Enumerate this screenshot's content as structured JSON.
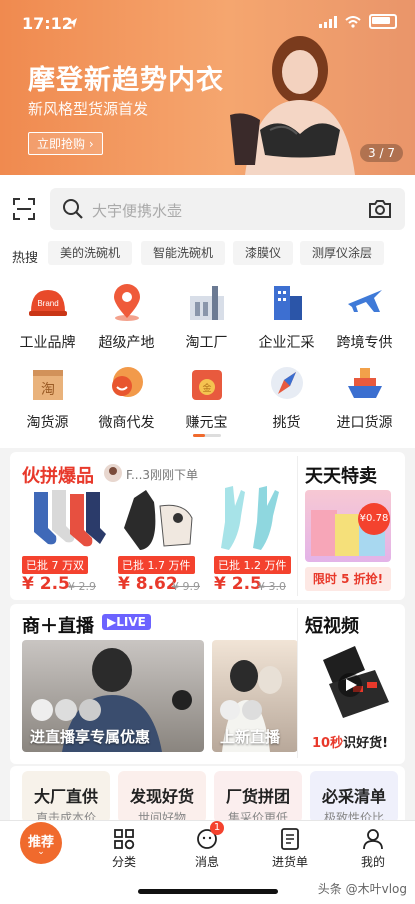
{
  "status": {
    "time": "17:12"
  },
  "banner": {
    "title": "摩登新趋势内衣",
    "subtitle": "新风格型货源首发",
    "button": "立即抢购",
    "page_indicator": "3 / 7"
  },
  "search": {
    "placeholder": "大宇便携水壶"
  },
  "hot": {
    "label": "热搜",
    "items": [
      "美的洗碗机",
      "智能洗碗机",
      "漆膜仪",
      "测厚仪涂层"
    ]
  },
  "categories": [
    {
      "label": "工业品牌",
      "brand_text": "Brand"
    },
    {
      "label": "超级产地"
    },
    {
      "label": "淘工厂"
    },
    {
      "label": "企业汇采"
    },
    {
      "label": "跨境专供"
    },
    {
      "label": "淘货源",
      "icon_text": "淘"
    },
    {
      "label": "微商代发"
    },
    {
      "label": "赚元宝",
      "icon_text": "金"
    },
    {
      "label": "挑货"
    },
    {
      "label": "进口货源"
    }
  ],
  "group_buy": {
    "title": "伙拼爆品",
    "ticker": "F...3刚刚下单",
    "products": [
      {
        "tag": "已批 7 万双",
        "price": "¥ 2.5",
        "original": "¥ 2.9"
      },
      {
        "tag": "已批 1.7 万件",
        "price": "¥ 8.62",
        "original": "¥ 9.9"
      },
      {
        "tag": "已批 1.2 万件",
        "price": "¥ 2.5",
        "original": "¥ 3.0"
      }
    ]
  },
  "daily_sale": {
    "title": "天天特卖",
    "price_badge": "¥0.78",
    "promo": "限时 5 折抢!"
  },
  "live": {
    "title": "商＋直播",
    "badge": "LIVE",
    "caption1": "进直播享专属优惠",
    "caption2": "上新直播"
  },
  "short_video": {
    "title": "短视频",
    "caption_red": "10秒",
    "caption_rest": "识好货!"
  },
  "tiles": [
    {
      "title": "大厂直供",
      "sub": "直击成本价"
    },
    {
      "title": "发现好货",
      "sub": "世间好物"
    },
    {
      "title": "厂货拼团",
      "sub": "集采价更低"
    },
    {
      "title": "必采清单",
      "sub": "极致性价比"
    }
  ],
  "tabbar": {
    "items": [
      {
        "label": "推荐",
        "icon": "home-circle-icon"
      },
      {
        "label": "分类",
        "icon": "grid-icon"
      },
      {
        "label": "消息",
        "icon": "message-icon",
        "badge": "1"
      },
      {
        "label": "进货单",
        "icon": "list-icon"
      },
      {
        "label": "我的",
        "icon": "user-icon"
      }
    ]
  },
  "watermark": "头条 @木叶vlog",
  "colors": {
    "accent": "#f06a2d",
    "red": "#e8392b",
    "live": "#6c63ff"
  }
}
